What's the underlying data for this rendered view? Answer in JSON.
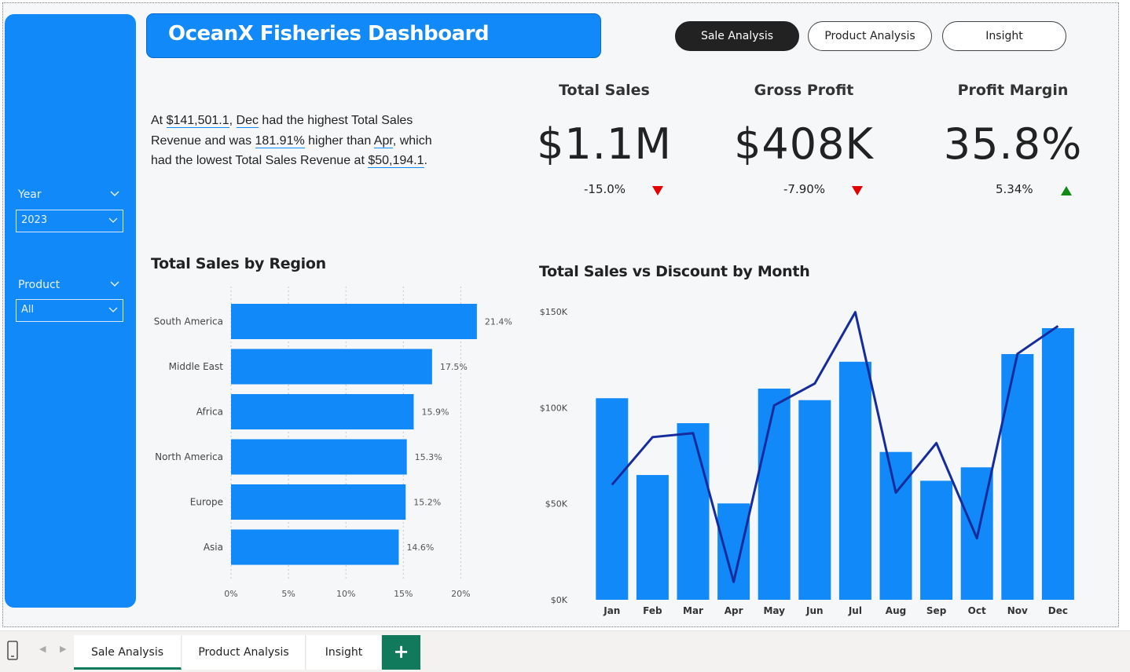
{
  "header": {
    "title": "OceanX Fisheries Dashboard"
  },
  "nav": {
    "buttons": [
      "Sale Analysis",
      "Product Analysis",
      "Insight"
    ],
    "active": "Sale Analysis"
  },
  "filters": {
    "year": {
      "label": "Year",
      "value": "2023"
    },
    "product": {
      "label": "Product",
      "value": "All"
    }
  },
  "narrative": {
    "t1": "At ",
    "h1": "$141,501.1",
    "t2": ", ",
    "h2": "Dec",
    "t3": " had the highest Total Sales Revenue and was ",
    "h3": "181.91%",
    "t4": " higher than ",
    "h4": "Apr",
    "t5": ", which had the lowest Total Sales Revenue at ",
    "h5": "$50,194.1",
    "t6": "."
  },
  "kpis": [
    {
      "title": "Total Sales",
      "value": "$1.1M",
      "change": "-15.0%",
      "trend": "down"
    },
    {
      "title": "Gross Profit",
      "value": "$408K",
      "change": "-7.90%",
      "trend": "down"
    },
    {
      "title": "Profit Margin",
      "value": "35.8%",
      "change": "5.34%",
      "trend": "up"
    }
  ],
  "colors": {
    "accent": "#1289f8",
    "line": "#162b9c",
    "down": "#e30000",
    "up": "#118b11",
    "tab_active": "#127a5c"
  },
  "chart_data": [
    {
      "type": "bar",
      "orientation": "horizontal",
      "title": "Total Sales by Region",
      "categories": [
        "South America",
        "Middle East",
        "Africa",
        "North America",
        "Europe",
        "Asia"
      ],
      "values": [
        21.4,
        17.5,
        15.9,
        15.3,
        15.2,
        14.6
      ],
      "value_labels": [
        "21.4%",
        "17.5%",
        "15.9%",
        "15.3%",
        "15.2%",
        "14.6%"
      ],
      "xlim": [
        0,
        22
      ],
      "xticks": [
        0,
        5,
        10,
        15,
        20
      ],
      "xtick_labels": [
        "0%",
        "5%",
        "10%",
        "15%",
        "20%"
      ],
      "grid": true
    },
    {
      "type": "bar",
      "title": "Total Sales vs Discount by Month",
      "categories": [
        "Jan",
        "Feb",
        "Mar",
        "Apr",
        "May",
        "Jun",
        "Jul",
        "Aug",
        "Sep",
        "Oct",
        "Nov",
        "Dec"
      ],
      "series": [
        {
          "type": "bar",
          "values": [
            105000,
            65000,
            92000,
            50194.1,
            110000,
            104000,
            124000,
            77000,
            62000,
            69000,
            128000,
            141501.1
          ]
        },
        {
          "type": "line",
          "values": [
            0.58,
            0.82,
            0.84,
            0.09,
            0.98,
            1.09,
            1.45,
            0.54,
            0.79,
            0.31,
            1.24,
            1.38
          ]
        }
      ],
      "ylim": [
        0,
        155000
      ],
      "yticks": [
        0,
        50000,
        100000,
        150000
      ],
      "ytick_labels": [
        "$0K",
        "$50K",
        "$100K",
        "$150K"
      ],
      "y2lim": [
        0,
        1.5
      ]
    }
  ],
  "tabs": {
    "items": [
      "Sale Analysis",
      "Product Analysis",
      "Insight"
    ],
    "active": "Sale Analysis",
    "add": "+"
  }
}
